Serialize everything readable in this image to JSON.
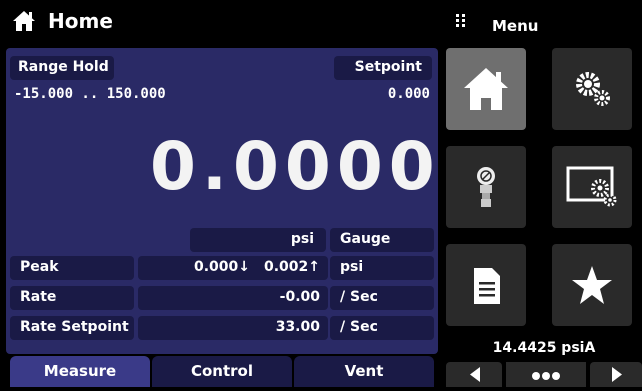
{
  "header": {
    "title": "Home",
    "home_icon": "home-icon"
  },
  "menu": {
    "title": "Menu",
    "icon": "grid-icon"
  },
  "display": {
    "range_hold_label": "Range Hold",
    "range_value": "-15.000 .. 150.000",
    "setpoint_label": "Setpoint",
    "setpoint_value": "0.000",
    "reading": "0.0000",
    "unit": "psi",
    "mode": "Gauge"
  },
  "rows": {
    "peak": {
      "label": "Peak",
      "min": "0.000↓",
      "max": "0.002↑",
      "unit": "psi"
    },
    "rate": {
      "label": "Rate",
      "value": "-0.00",
      "unit": "/ Sec"
    },
    "rate_setpoint": {
      "label": "Rate Setpoint",
      "value": "33.00",
      "unit": "/ Sec"
    }
  },
  "tabs": [
    {
      "label": "Measure",
      "active": true
    },
    {
      "label": "Control",
      "active": false
    },
    {
      "label": "Vent",
      "active": false
    }
  ],
  "tiles": [
    {
      "icon": "home-icon",
      "active": true
    },
    {
      "icon": "settings-gears-icon"
    },
    {
      "icon": "sensor-icon"
    },
    {
      "icon": "display-settings-icon"
    },
    {
      "icon": "document-icon"
    },
    {
      "icon": "star-icon"
    }
  ],
  "barometer": {
    "reading": "14.4425 psiA"
  },
  "colors": {
    "panel": "#2a2a66",
    "cell": "#1a1a46",
    "tab_active": "#3a3a88",
    "tile": "#2a2a2a",
    "tile_active": "#6f6f6f"
  }
}
